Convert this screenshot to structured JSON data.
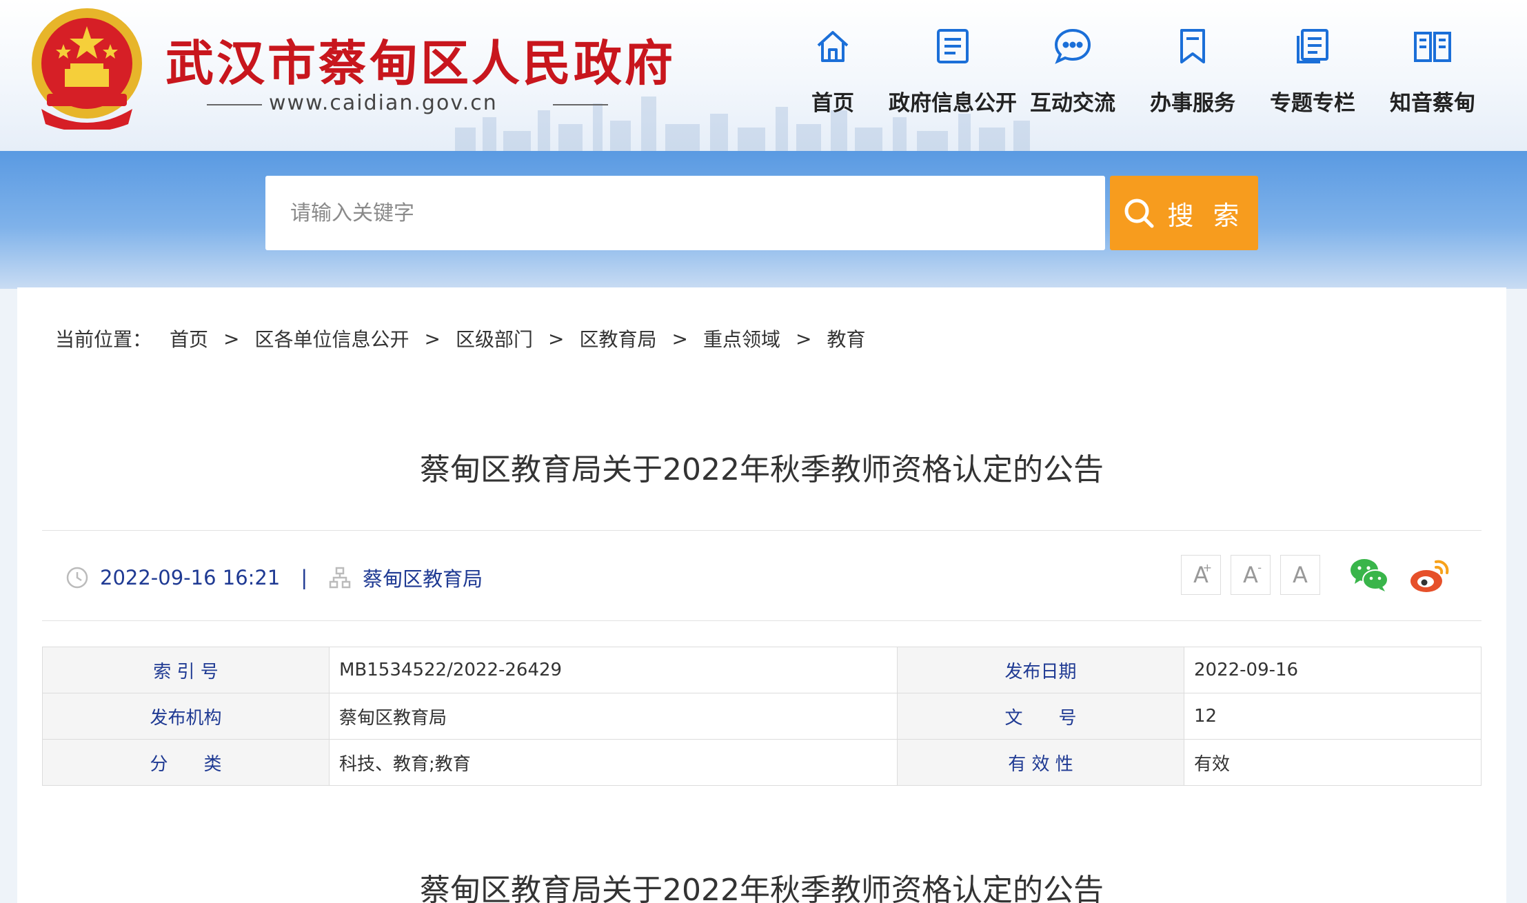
{
  "header": {
    "site_title": "武汉市蔡甸区人民政府",
    "site_url": "www.caidian.gov.cn",
    "nav": [
      {
        "label": "首页",
        "icon": "home-icon"
      },
      {
        "label": "政府信息公开",
        "icon": "document-icon"
      },
      {
        "label": "互动交流",
        "icon": "chat-icon"
      },
      {
        "label": "办事服务",
        "icon": "bookmark-icon"
      },
      {
        "label": "专题专栏",
        "icon": "folder-icon"
      },
      {
        "label": "知音蔡甸",
        "icon": "book-icon"
      }
    ]
  },
  "search": {
    "placeholder": "请输入关键字",
    "button_label": "搜 索"
  },
  "breadcrumb": {
    "lead": "当前位置：",
    "items": [
      "首页",
      "区各单位信息公开",
      "区级部门",
      "区教育局",
      "重点领域",
      "教育"
    ],
    "separator": ">"
  },
  "article": {
    "title": "蔡甸区教育局关于2022年秋季教师资格认定的公告",
    "datetime": "2022-09-16 16:21",
    "meta_separator": "|",
    "publisher": "蔡甸区教育局",
    "font_buttons": [
      "A",
      "A",
      "A"
    ],
    "font_marks": [
      "+",
      "-"
    ],
    "info": {
      "index_label": "索 引 号",
      "index_value": "MB1534522/2022-26429",
      "date_label": "发布日期",
      "date_value": "2022-09-16",
      "org_label": "发布机构",
      "org_value": "蔡甸区教育局",
      "docno_label": "文　　号",
      "docno_value": "12",
      "cat_label": "分　　类",
      "cat_value": "科技、教育;教育",
      "validity_label": "有 效 性",
      "validity_value": "有效"
    },
    "body_title": "蔡甸区教育局关于2022年秋季教师资格认定的公告"
  },
  "colors": {
    "brand_red": "#c8161d",
    "search_orange": "#f79c1e",
    "nav_blue": "#1b6fd8",
    "meta_blue": "#1f3a93"
  }
}
